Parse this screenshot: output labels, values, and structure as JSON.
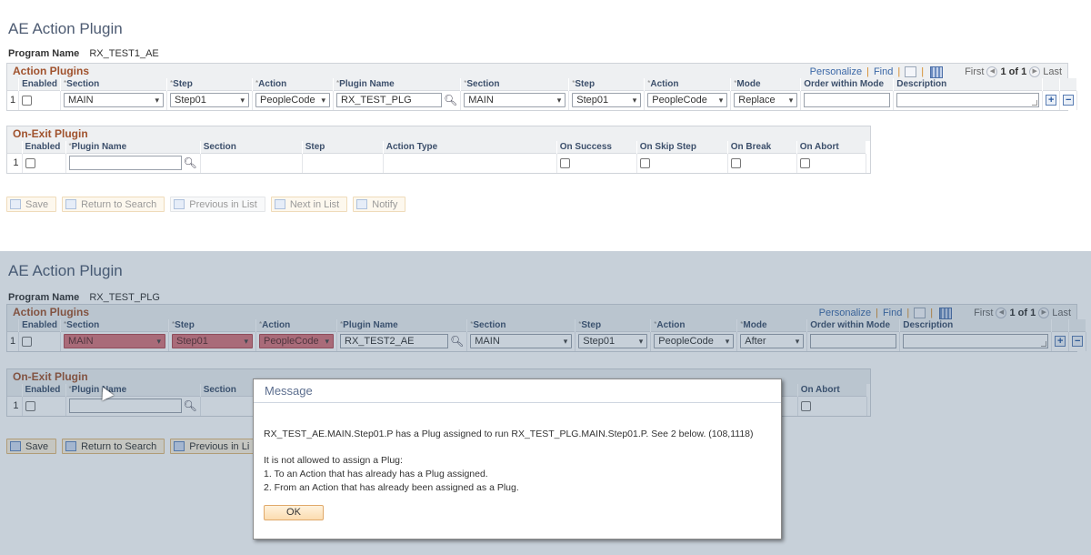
{
  "panel1": {
    "title": "AE Action Plugin",
    "program_label": "Program Name",
    "program_value": "RX_TEST1_AE",
    "action_plugins": {
      "title": "Action Plugins",
      "nav": {
        "personalize": "Personalize",
        "find": "Find",
        "first": "First",
        "count": "1 of 1",
        "last": "Last"
      },
      "headers": {
        "enabled": "Enabled",
        "section": "Section",
        "step": "Step",
        "action": "Action",
        "plugin_name": "Plugin Name",
        "section2": "Section",
        "step2": "Step",
        "action2": "Action",
        "mode": "Mode",
        "order": "Order within Mode",
        "description": "Description"
      },
      "row": {
        "num": "1",
        "enabled": false,
        "section": "MAIN",
        "step": "Step01",
        "action": "PeopleCode",
        "plugin_name": "RX_TEST_PLG",
        "section2": "MAIN",
        "step2": "Step01",
        "action2": "PeopleCode",
        "mode": "Replace",
        "order": "",
        "description": ""
      }
    },
    "on_exit": {
      "title": "On-Exit Plugin",
      "headers": {
        "enabled": "Enabled",
        "plugin_name": "Plugin Name",
        "section": "Section",
        "step": "Step",
        "action_type": "Action Type",
        "on_success": "On Success",
        "on_skip": "On Skip Step",
        "on_break": "On Break",
        "on_abort": "On Abort"
      },
      "row": {
        "num": "1",
        "plugin_name": ""
      }
    },
    "buttons": {
      "save": "Save",
      "return": "Return to Search",
      "previous": "Previous in List",
      "next": "Next in List",
      "notify": "Notify"
    }
  },
  "panel2": {
    "title": "AE Action Plugin",
    "program_label": "Program Name",
    "program_value": "RX_TEST_PLG",
    "action_plugins": {
      "title": "Action Plugins",
      "nav": {
        "personalize": "Personalize",
        "find": "Find",
        "first": "First",
        "count": "1 of 1",
        "last": "Last"
      },
      "headers": {
        "enabled": "Enabled",
        "section": "Section",
        "step": "Step",
        "action": "Action",
        "plugin_name": "Plugin Name",
        "section2": "Section",
        "step2": "Step",
        "action2": "Action",
        "mode": "Mode",
        "order": "Order within Mode",
        "description": "Description"
      },
      "row": {
        "num": "1",
        "enabled": false,
        "section": "MAIN",
        "step": "Step01",
        "action": "PeopleCode",
        "plugin_name": "RX_TEST2_AE",
        "section2": "MAIN",
        "step2": "Step01",
        "action2": "PeopleCode",
        "mode": "After",
        "order": "",
        "description": ""
      }
    },
    "on_exit": {
      "title": "On-Exit Plugin",
      "headers": {
        "enabled": "Enabled",
        "plugin_name": "Plugin Name",
        "section": "Section",
        "on_abort": "On Abort"
      },
      "row": {
        "num": "1",
        "plugin_name": ""
      }
    },
    "buttons": {
      "save": "Save",
      "return": "Return to Search",
      "previous": "Previous in Li"
    }
  },
  "dialog": {
    "title": "Message",
    "line1": "RX_TEST_AE.MAIN.Step01.P has a Plug assigned to run RX_TEST_PLG.MAIN.Step01.P. See 2 below. (108,1118)",
    "line2": "It is not allowed to assign a Plug:",
    "line3": "1. To an Action that has already has a Plug assigned.",
    "line4": "2. From an Action that has already been assigned as a Plug.",
    "ok": "OK"
  },
  "colors": {
    "error_field": "#d6737b",
    "grid_title": "#a0522d",
    "link": "#3a67a6",
    "overlay": "#c5d0dc"
  }
}
